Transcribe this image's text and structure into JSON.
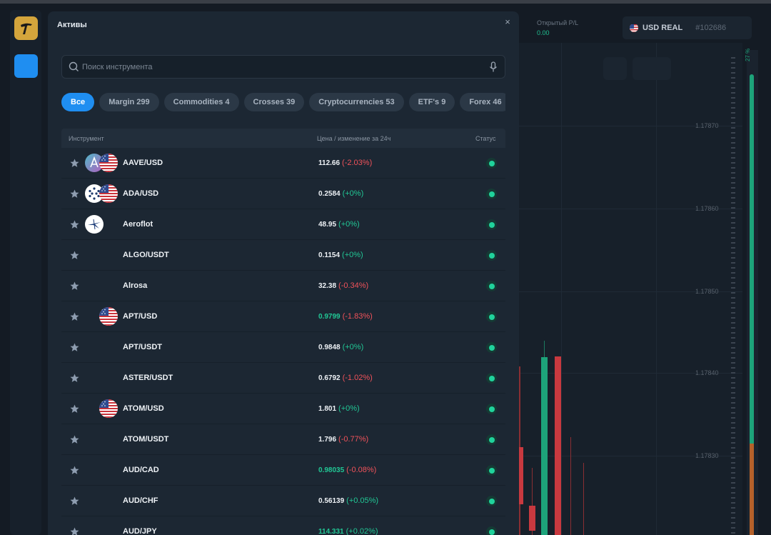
{
  "header": {
    "pl_label": "Открытый P/L",
    "pl_value": "0.00",
    "account_name": "USD REAL",
    "account_id": "#102686"
  },
  "chart_bg": {
    "price_labels": [
      "1.17870",
      "1.17860",
      "1.17850",
      "1.17840",
      "1.17830"
    ],
    "meter_pct": "27 %"
  },
  "modal": {
    "title": "Активы",
    "close_label": "×",
    "search_placeholder": "Поиск инструмента",
    "chips": [
      {
        "label": "Все"
      },
      {
        "label": "Margin 299"
      },
      {
        "label": "Commodities 4"
      },
      {
        "label": "Crosses 39"
      },
      {
        "label": "Cryptocurrencies 53"
      },
      {
        "label": "ETF's 9"
      },
      {
        "label": "Forex 46"
      }
    ],
    "columns": {
      "instrument": "Инструмент",
      "price": "Цена / изменение за 24ч",
      "status": "Статус"
    },
    "rows": [
      {
        "symbol": "AAVE/USD",
        "price": "112.66",
        "change": "(-2.03%)",
        "dir": "neg",
        "price_color": "white",
        "icons": [
          "aave",
          "us"
        ]
      },
      {
        "symbol": "ADA/USD",
        "price": "0.2584",
        "change": "(+0%)",
        "dir": "pos",
        "price_color": "white",
        "icons": [
          "ada",
          "us"
        ]
      },
      {
        "symbol": "Aeroflot",
        "price": "48.95",
        "change": "(+0%)",
        "dir": "pos",
        "price_color": "white",
        "icons": [
          "aeroflot"
        ]
      },
      {
        "symbol": "ALGO/USDT",
        "price": "0.1154",
        "change": "(+0%)",
        "dir": "pos",
        "price_color": "white",
        "icons": []
      },
      {
        "symbol": "Alrosa",
        "price": "32.38",
        "change": "(-0.34%)",
        "dir": "neg",
        "price_color": "white",
        "icons": []
      },
      {
        "symbol": "APT/USD",
        "price": "0.9799",
        "change": "(-1.83%)",
        "dir": "neg",
        "price_color": "green",
        "icons": [
          "us2"
        ]
      },
      {
        "symbol": "APT/USDT",
        "price": "0.9848",
        "change": "(+0%)",
        "dir": "pos",
        "price_color": "white",
        "icons": []
      },
      {
        "symbol": "ASTER/USDT",
        "price": "0.6792",
        "change": "(-1.02%)",
        "dir": "neg",
        "price_color": "white",
        "icons": []
      },
      {
        "symbol": "ATOM/USD",
        "price": "1.801",
        "change": "(+0%)",
        "dir": "pos",
        "price_color": "white",
        "icons": [
          "us2"
        ]
      },
      {
        "symbol": "ATOM/USDT",
        "price": "1.796",
        "change": "(-0.77%)",
        "dir": "neg",
        "price_color": "white",
        "icons": []
      },
      {
        "symbol": "AUD/CAD",
        "price": "0.98035",
        "change": "(-0.08%)",
        "dir": "neg",
        "price_color": "green",
        "icons": []
      },
      {
        "symbol": "AUD/CHF",
        "price": "0.56139",
        "change": "(+0.05%)",
        "dir": "pos",
        "price_color": "white",
        "icons": []
      },
      {
        "symbol": "AUD/JPY",
        "price": "114.331",
        "change": "(+0.02%)",
        "dir": "pos",
        "price_color": "green",
        "icons": []
      }
    ]
  },
  "colors": {
    "accent": "#1f8ef1",
    "positive": "#21c795",
    "negative": "#f0525a",
    "status_online": "#20d39c"
  }
}
